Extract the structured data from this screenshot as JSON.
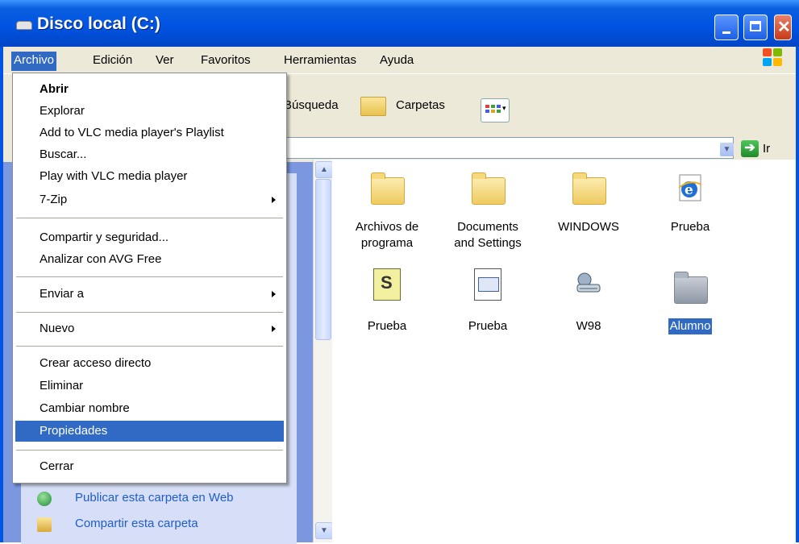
{
  "window": {
    "title": "Disco local (C:)"
  },
  "menubar": {
    "items": [
      "Archivo",
      "Edición",
      "Ver",
      "Favoritos",
      "Herramientas",
      "Ayuda"
    ],
    "active": "Archivo"
  },
  "toolbar": {
    "search_label": "Búsqueda",
    "folders_label": "Carpetas"
  },
  "addressbar": {
    "go_label": "Ir"
  },
  "file_menu": {
    "items": [
      {
        "label": "Abrir",
        "bold": true
      },
      {
        "label": "Explorar"
      },
      {
        "label": "Add to VLC media player's Playlist"
      },
      {
        "label": "Buscar..."
      },
      {
        "label": "Play with VLC media player"
      },
      {
        "label": "7-Zip",
        "submenu": true
      },
      {
        "label": "Compartir y seguridad..."
      },
      {
        "label": "Analizar con AVG Free"
      },
      {
        "label": "Enviar a",
        "submenu": true
      },
      {
        "label": "Nuevo",
        "submenu": true
      },
      {
        "label": "Crear acceso directo"
      },
      {
        "label": "Eliminar"
      },
      {
        "label": "Cambiar nombre"
      },
      {
        "label": "Propiedades",
        "highlighted": true
      },
      {
        "label": "Cerrar"
      }
    ]
  },
  "task_pane": {
    "links": [
      "Publicar esta carpeta en Web",
      "Compartir esta carpeta"
    ]
  },
  "files": [
    {
      "name_line1": "Archivos de",
      "name_line2": "programa",
      "icon": "folder-icon"
    },
    {
      "name_line1": "Documents",
      "name_line2": "and Settings",
      "icon": "folder-icon"
    },
    {
      "name_line1": "WINDOWS",
      "name_line2": "",
      "icon": "folder-icon"
    },
    {
      "name_line1": "Prueba",
      "name_line2": "",
      "icon": "ie-html-icon"
    },
    {
      "name_line1": "Prueba",
      "name_line2": "",
      "icon": "script-file-icon"
    },
    {
      "name_line1": "Prueba",
      "name_line2": "",
      "icon": "window-file-icon"
    },
    {
      "name_line1": "W98",
      "name_line2": "",
      "icon": "network-drive-icon"
    },
    {
      "name_line1": "Alumno",
      "name_line2": "",
      "icon": "gray-folder-icon",
      "selected": true
    }
  ],
  "colors": {
    "titlebar": "#0054e3",
    "selection": "#316ac5",
    "menubar": "#ece9d8",
    "task_pane": "#7b97e0"
  }
}
